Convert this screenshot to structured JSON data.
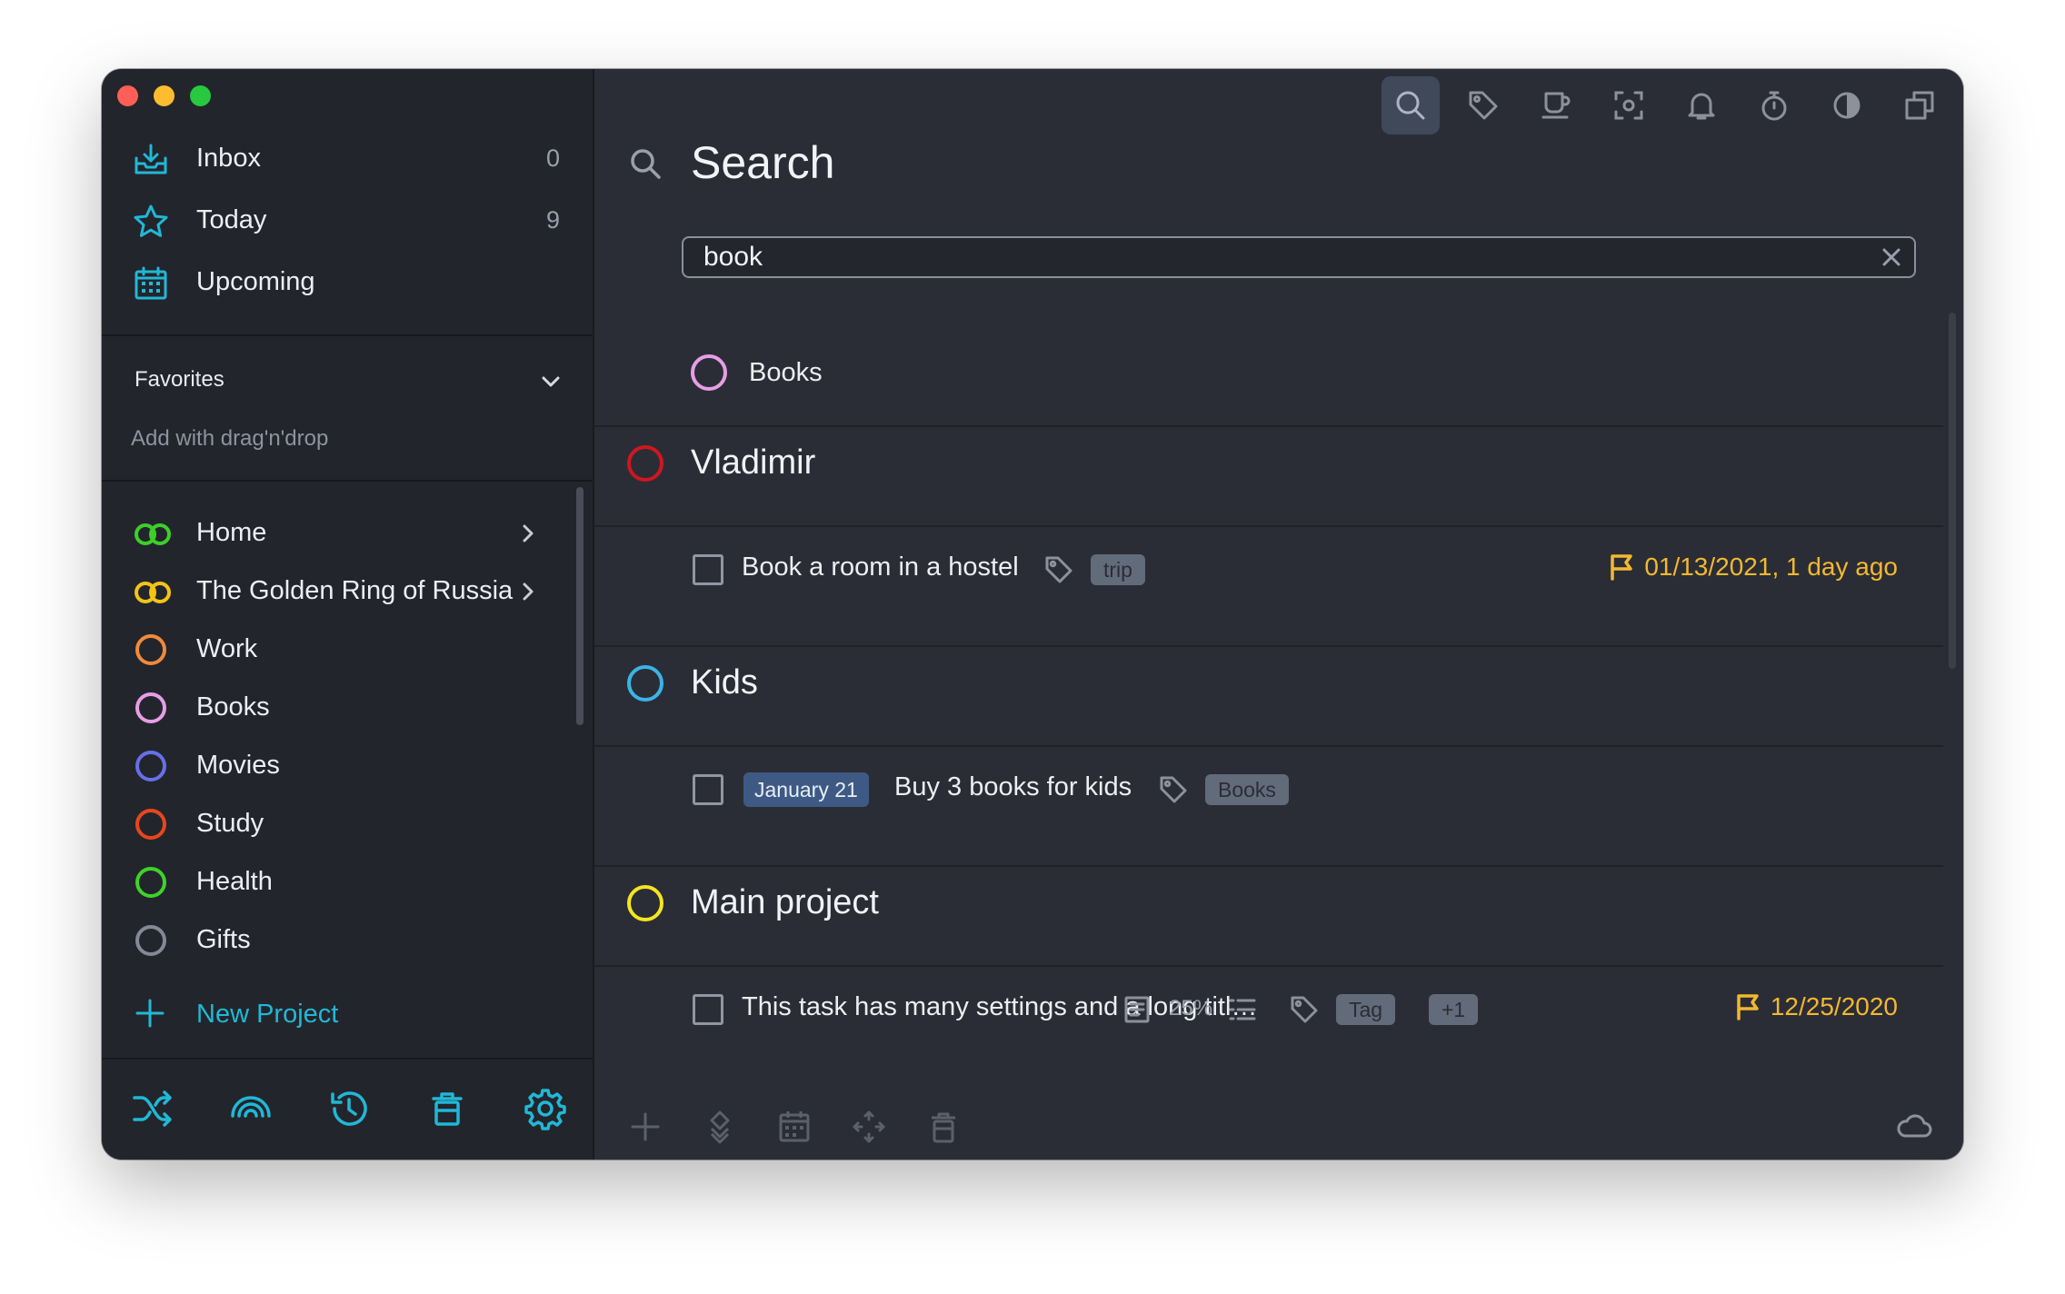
{
  "sidebar": {
    "nav": [
      {
        "label": "Inbox",
        "count": "0",
        "icon": "inbox-tray-icon"
      },
      {
        "label": "Today",
        "count": "9",
        "icon": "star-icon"
      },
      {
        "label": "Upcoming",
        "count": "",
        "icon": "calendar-icon"
      }
    ],
    "favorites": {
      "title": "Favorites",
      "hint": "Add with drag'n'drop"
    },
    "projects": [
      {
        "label": "Home",
        "color": "#3ccf2a",
        "type": "group",
        "has_children": true
      },
      {
        "label": "The Golden Ring of Russia",
        "color": "#f2c318",
        "type": "group",
        "has_children": true
      },
      {
        "label": "Work",
        "color": "#f08a3c",
        "type": "project",
        "has_children": false
      },
      {
        "label": "Books",
        "color": "#e69ee6",
        "type": "project",
        "has_children": false
      },
      {
        "label": "Movies",
        "color": "#6670e8",
        "type": "project",
        "has_children": false
      },
      {
        "label": "Study",
        "color": "#e8461e",
        "type": "project",
        "has_children": false
      },
      {
        "label": "Health",
        "color": "#3fd22a",
        "type": "project",
        "has_children": false
      },
      {
        "label": "Gifts",
        "color": "#838996",
        "type": "project",
        "has_children": false
      }
    ],
    "new_project_label": "New Project",
    "bottom_icons": [
      "shuffle-icon",
      "rainbow-icon",
      "history-icon",
      "trash-icon",
      "settings-gear-icon"
    ]
  },
  "toolbar": {
    "icons": [
      "search-icon",
      "tag-icon",
      "coffee-cup-icon",
      "focus-frame-icon",
      "bell-icon",
      "stopwatch-icon",
      "theme-contrast-icon",
      "duplicate-window-icon"
    ],
    "active": "search-icon"
  },
  "search": {
    "title": "Search",
    "query": "book",
    "placeholder": ""
  },
  "results": {
    "project_match": {
      "label": "Books",
      "color": "#e69ee6"
    },
    "groups": [
      {
        "name": "Vladimir",
        "color": "#d0161e",
        "tasks": [
          {
            "title": "Book a room in a hostel",
            "tags": [
              "trip"
            ],
            "due": "01/13/2021, 1 day ago"
          }
        ]
      },
      {
        "name": "Kids",
        "color": "#3ab4e8",
        "tasks": [
          {
            "date_badge": "January 21",
            "title": "Buy 3 books for kids",
            "tags": [
              "Books"
            ]
          }
        ]
      },
      {
        "name": "Main project",
        "color": "#f5e520",
        "tasks": [
          {
            "title": "This task has many settings and a long titl…",
            "progress": "25%",
            "tags": [
              "Tag",
              "+1"
            ],
            "due": "12/25/2020"
          }
        ]
      }
    ]
  },
  "bottom_actions": [
    "add-icon",
    "move-icon",
    "schedule-calendar-icon",
    "move-arrows-icon",
    "delete-icon",
    "cloud-sync-icon"
  ],
  "colors": {
    "accent": "#21b8d6",
    "due": "#f2b830",
    "sidebar_bg": "#23252c",
    "main_bg": "#2b2d36"
  }
}
